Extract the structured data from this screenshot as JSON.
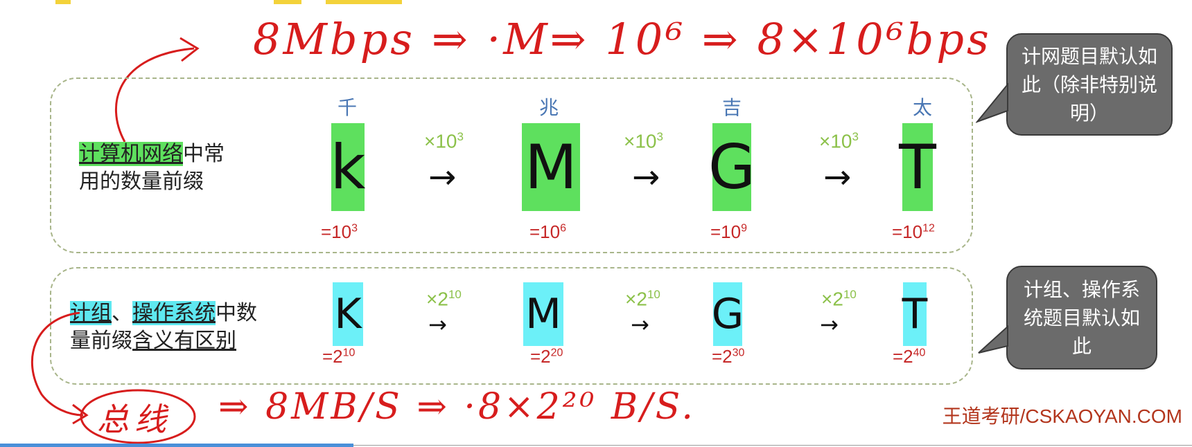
{
  "annotations": {
    "top": "8Mbps ⇒ ·M⇒ 10⁶ ⇒ 8×10⁶bps",
    "bottom_circle": "总线",
    "bottom": "⇒ 8MB/S ⇒ ·8×2²⁰ B/S."
  },
  "row1": {
    "label_highlight": "计算机网络",
    "label_rest1": "中常",
    "label_line2": "用的数量前缀",
    "prefixes": [
      {
        "cn": "千",
        "letter": "k",
        "base": "=10",
        "exp": "3"
      },
      {
        "cn": "兆",
        "letter": "M",
        "base": "=10",
        "exp": "6"
      },
      {
        "cn": "吉",
        "letter": "G",
        "base": "=10",
        "exp": "9"
      },
      {
        "cn": "太",
        "letter": "T",
        "base": "=10",
        "exp": "12"
      }
    ],
    "multiplier": {
      "sign": "×",
      "base": "10",
      "exp": "3"
    },
    "arrow": "→"
  },
  "row2": {
    "label_hl1": "计组",
    "label_sep": "、",
    "label_hl2": "操作系统",
    "label_rest1": "中数",
    "label_line2a": "量前缀",
    "label_line2b": "含义有区别",
    "prefixes": [
      {
        "letter": "K",
        "base": "=2",
        "exp": "10"
      },
      {
        "letter": "M",
        "base": "=2",
        "exp": "20"
      },
      {
        "letter": "G",
        "base": "=2",
        "exp": "30"
      },
      {
        "letter": "T",
        "base": "=2",
        "exp": "40"
      }
    ],
    "multiplier": {
      "sign": "×",
      "base": "2",
      "exp": "10"
    },
    "arrow": "→"
  },
  "callouts": {
    "network": "计网题目默认如此（除非特别说明）",
    "os": "计组、操作系统题目默认如此"
  },
  "brand": "王道考研/CSKAOYAN.COM",
  "colors": {
    "green_highlight": "#5ee05e",
    "cyan_highlight": "#6cf0f8",
    "handwriting_red": "#d71d1d",
    "value_red": "#c62828",
    "multiplier_green": "#8cc14a",
    "chinese_blue": "#4a77b4",
    "callout_gray": "#6b6b6b"
  }
}
